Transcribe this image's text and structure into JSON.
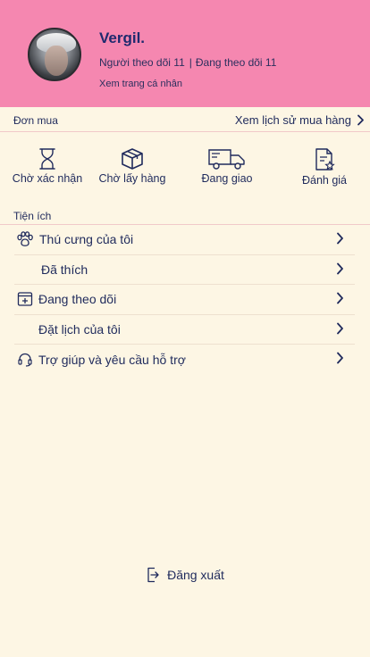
{
  "profile": {
    "username": "Vergil.",
    "followers_text": "Người theo dõi 11",
    "following_text": "Đang theo dõi 11",
    "separator": "|",
    "view_profile": "Xem trang cá nhân"
  },
  "orders": {
    "title": "Đơn mua",
    "history_link": "Xem lịch sử mua hàng",
    "statuses": [
      {
        "label": "Chờ xác nhận",
        "icon": "hourglass-icon"
      },
      {
        "label": "Chờ lấy hàng",
        "icon": "box-icon"
      },
      {
        "label": "Đang giao",
        "icon": "truck-icon"
      },
      {
        "label": "Đánh giá",
        "icon": "review-document-icon"
      }
    ]
  },
  "utilities": {
    "title": "Tiện ích",
    "items": [
      {
        "label": "Thú cưng của tôi",
        "icon": "paw-icon"
      },
      {
        "label": "Đã thích",
        "icon": ""
      },
      {
        "label": "Đang theo dõi",
        "icon": "add-calendar-icon"
      },
      {
        "label": "Đặt lịch của tôi",
        "icon": ""
      },
      {
        "label": "Trợ giúp và yêu cầu hỗ trợ",
        "icon": "headset-icon"
      }
    ]
  },
  "logout": {
    "label": "Đăng xuất",
    "icon": "logout-icon"
  },
  "colors": {
    "header_bg": "#f587b0",
    "page_bg": "#fdf6e4",
    "text": "#1f2a5c",
    "divider": "#f1c9c9"
  }
}
